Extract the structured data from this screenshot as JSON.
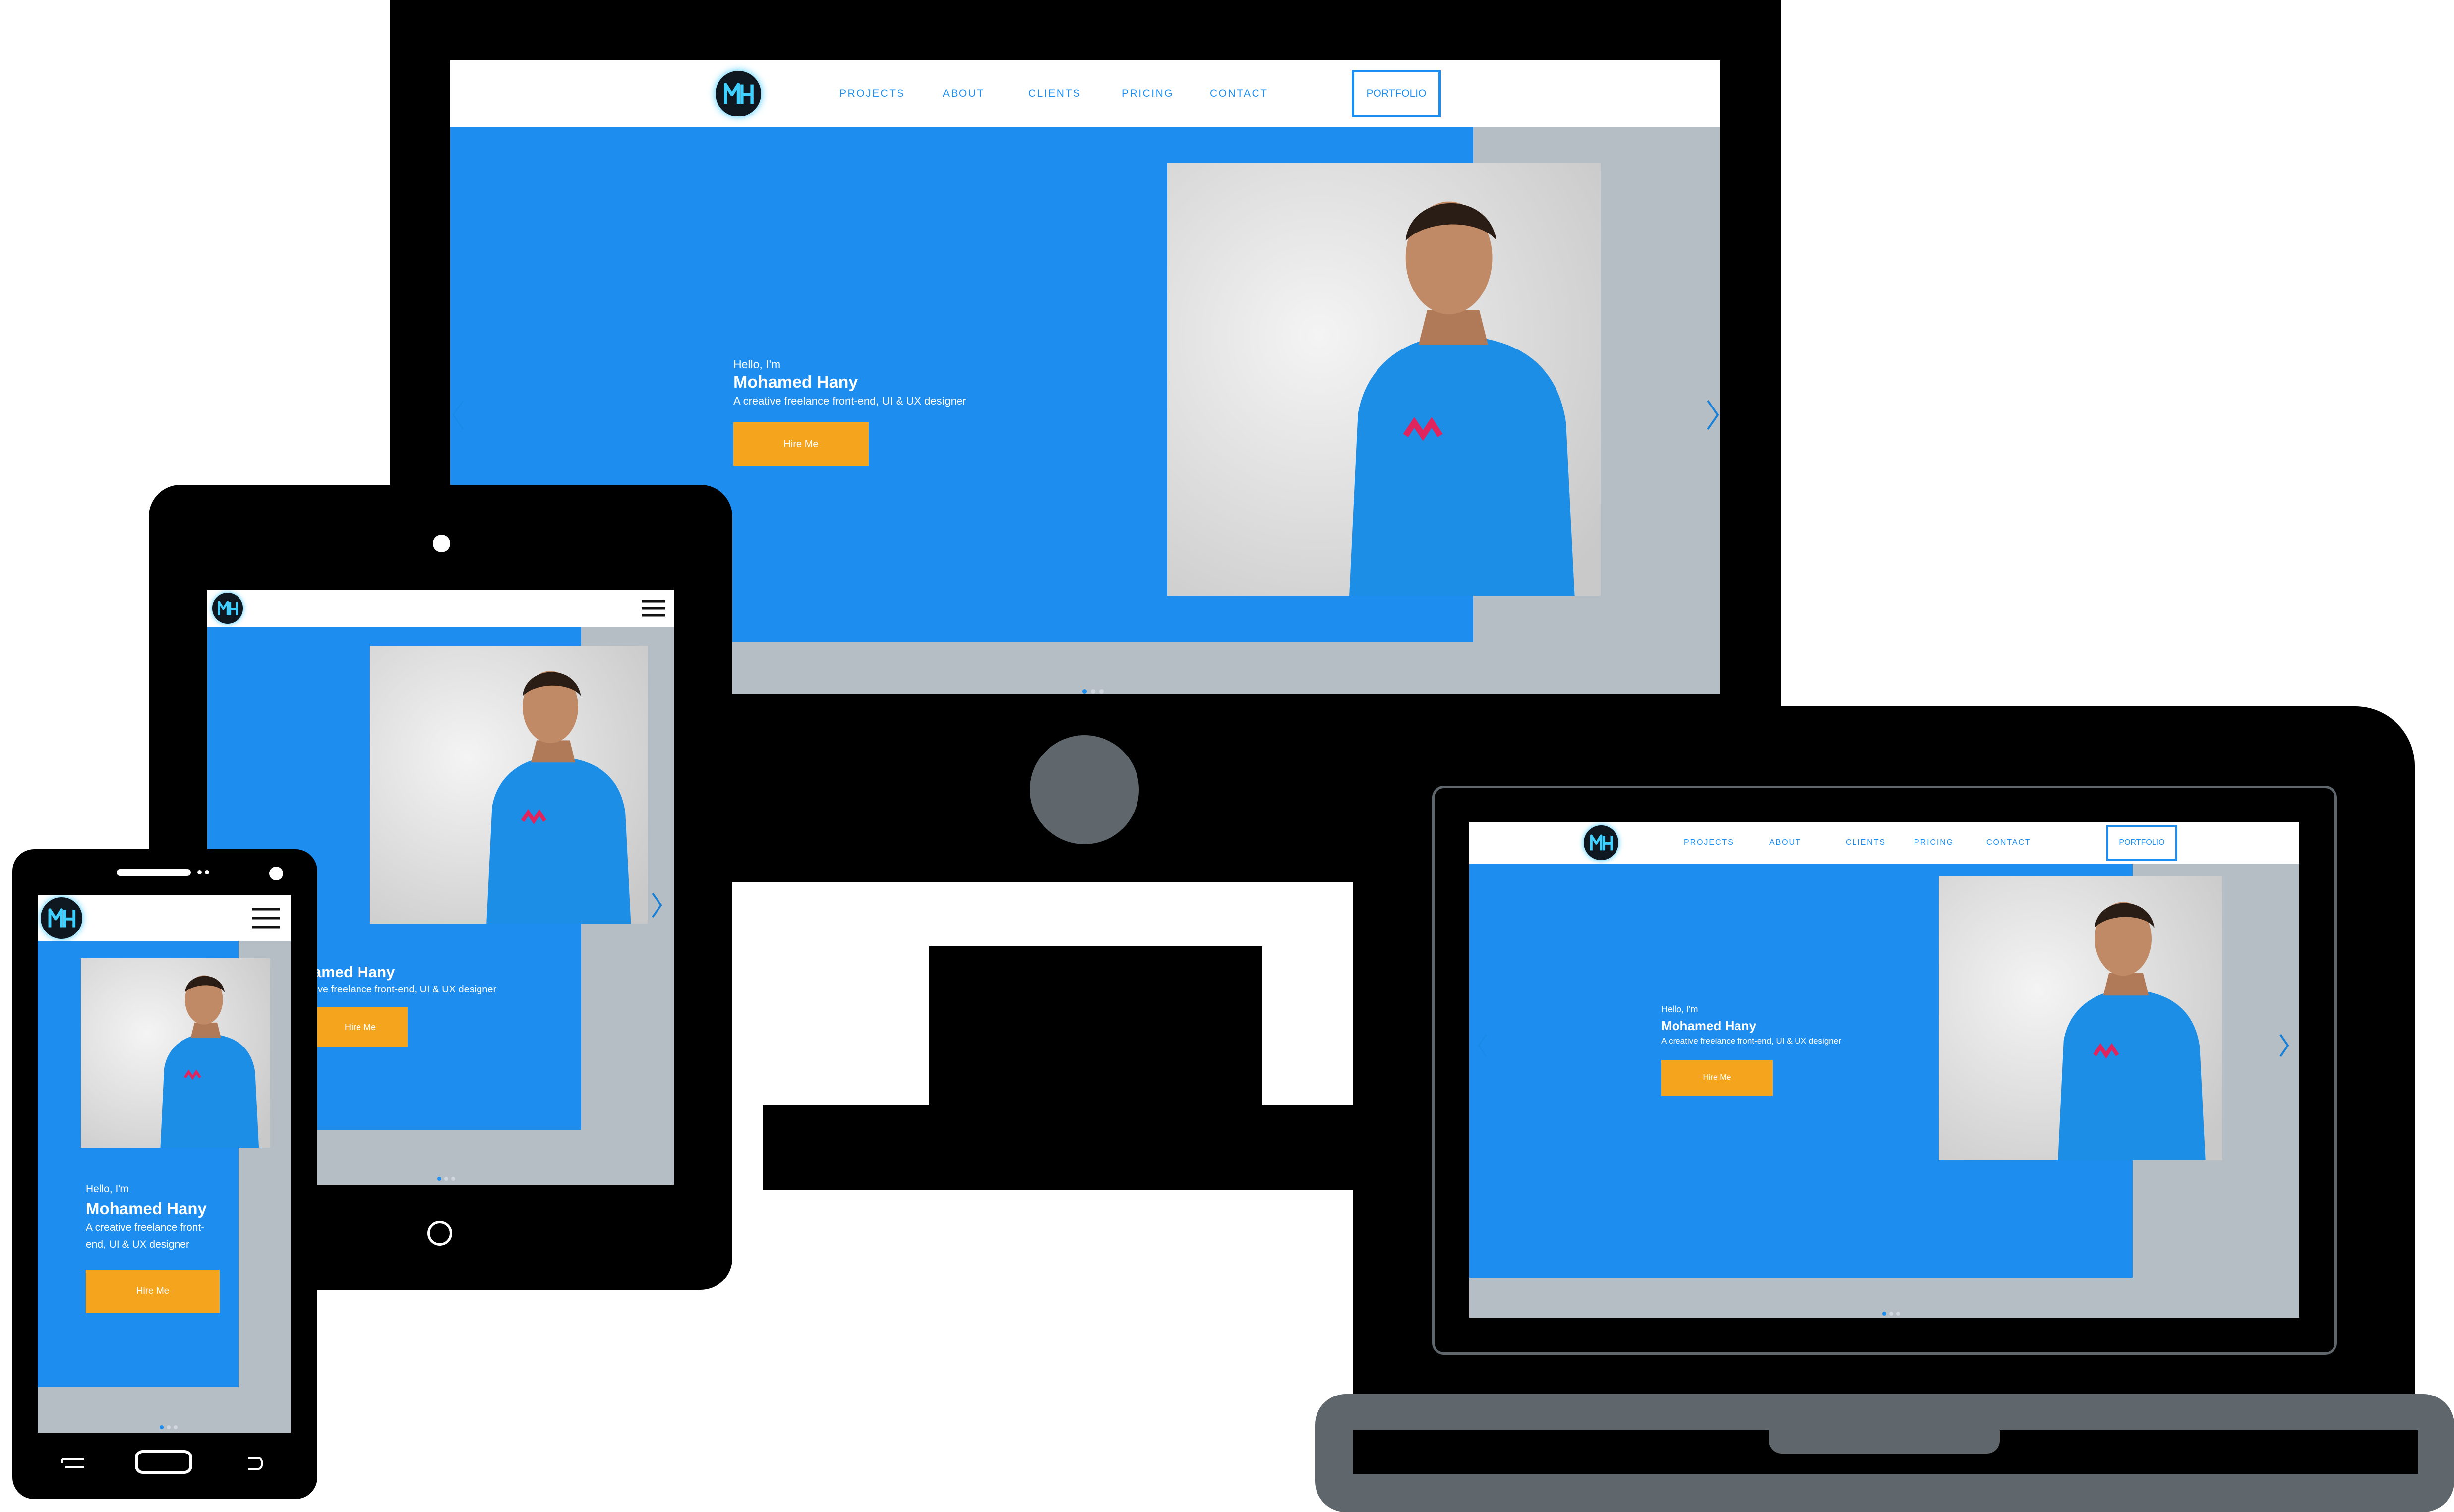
{
  "site": {
    "logo_text": "MH",
    "nav": [
      "PROJECTS",
      "ABOUT",
      "CLIENTS",
      "PRICING",
      "CONTACT"
    ],
    "portfolio_label": "PORTFOLIO",
    "hello": "Hello, I'm",
    "name": "Mohamed Hany",
    "role": "A creative freelance front-end, UI & UX designer",
    "role_line1": "A creative freelance front-",
    "role_line2": "end, UI & UX designer",
    "tablet_name": "amed Hany",
    "tablet_role": "tive freelance front-end, UI & UX designer",
    "hire_label": "Hire Me"
  },
  "colors": {
    "primary": "#1d8ef0",
    "accent": "#f5a41e",
    "panel": "#b5bec5",
    "device": "#000000",
    "device_gray": "#5f676c"
  }
}
